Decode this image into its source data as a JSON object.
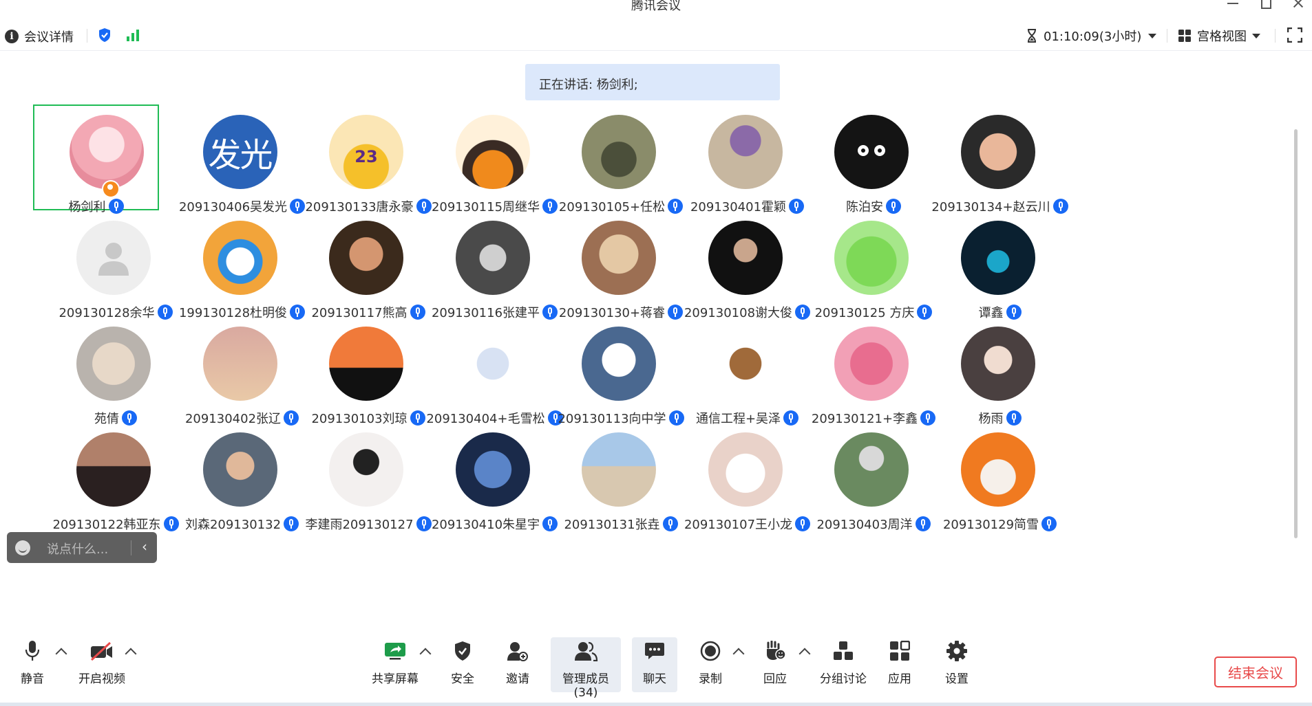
{
  "window": {
    "title": "腾讯会议"
  },
  "topbar": {
    "details_label": "会议详情",
    "timer": "01:10:09(3小时)",
    "view_label": "宫格视图"
  },
  "speaking": {
    "text": "正在讲话: 杨剑利;"
  },
  "participants": [
    {
      "name": "杨剑利",
      "avatar": "anime-girl-pink",
      "active": true,
      "host": true
    },
    {
      "name": "209130406吴发光",
      "avatar": "text-发光"
    },
    {
      "name": "209130133唐永豪",
      "avatar": "cartoon-lakers-23"
    },
    {
      "name": "209130115周继华",
      "avatar": "cartoon-boy-orange"
    },
    {
      "name": "209130105+任松",
      "avatar": "photo-clothes-chair"
    },
    {
      "name": "209130401霍颖",
      "avatar": "photo-bucket-hat"
    },
    {
      "name": "陈泊安",
      "avatar": "black-cat-eyes"
    },
    {
      "name": "209130134+赵云川",
      "avatar": "photo-child-peace"
    },
    {
      "name": "209130128余华",
      "avatar": "default-person"
    },
    {
      "name": "199130128杜明俊",
      "avatar": "doraemon-tiger"
    },
    {
      "name": "209130117熊高",
      "avatar": "photo-man-singing"
    },
    {
      "name": "209130116张建平",
      "avatar": "photo-bw-boy"
    },
    {
      "name": "209130130+蒋睿",
      "avatar": "photo-sunhat"
    },
    {
      "name": "209130108谢大俊",
      "avatar": "photo-man-dark"
    },
    {
      "name": "209130125 方庆",
      "avatar": "green-frog"
    },
    {
      "name": "谭鑫",
      "avatar": "glowing-paw"
    },
    {
      "name": "苑倩",
      "avatar": "photo-cat"
    },
    {
      "name": "209130402张辽",
      "avatar": "photo-balloons"
    },
    {
      "name": "209130103刘琼",
      "avatar": "photo-sunset-trees"
    },
    {
      "name": "209130404+毛雪松",
      "avatar": "sketch-figure"
    },
    {
      "name": "209130113向中学",
      "avatar": "anime-headphones"
    },
    {
      "name": "通信工程+吴泽",
      "avatar": "cartoon-bull-niu"
    },
    {
      "name": "209130121+李鑫",
      "avatar": "lotso-bear"
    },
    {
      "name": "杨雨",
      "avatar": "photo-girl"
    },
    {
      "name": "209130122韩亚东",
      "avatar": "photo-sunset-man"
    },
    {
      "name": "刘森209130132",
      "avatar": "photo-boy-window"
    },
    {
      "name": "李建雨209130127",
      "avatar": "sketch-girl"
    },
    {
      "name": "209130410朱星宇",
      "avatar": "robot-blue"
    },
    {
      "name": "209130131张垚",
      "avatar": "photo-man-sea"
    },
    {
      "name": "209130107王小龙",
      "avatar": "cartoon-sleeping"
    },
    {
      "name": "209130403周洋",
      "avatar": "photo-moon-astronaut"
    },
    {
      "name": "209130129简雪",
      "avatar": "cat-orange-hat"
    }
  ],
  "chat_popup": {
    "placeholder": "说点什么..."
  },
  "toolbar": {
    "mute": "静音",
    "video": "开启视频",
    "share": "共享屏幕",
    "security": "安全",
    "invite": "邀请",
    "members": "管理成员(34)",
    "chat": "聊天",
    "record": "录制",
    "reaction": "回应",
    "breakout": "分组讨论",
    "apps": "应用",
    "settings": "设置",
    "end": "结束会议"
  }
}
